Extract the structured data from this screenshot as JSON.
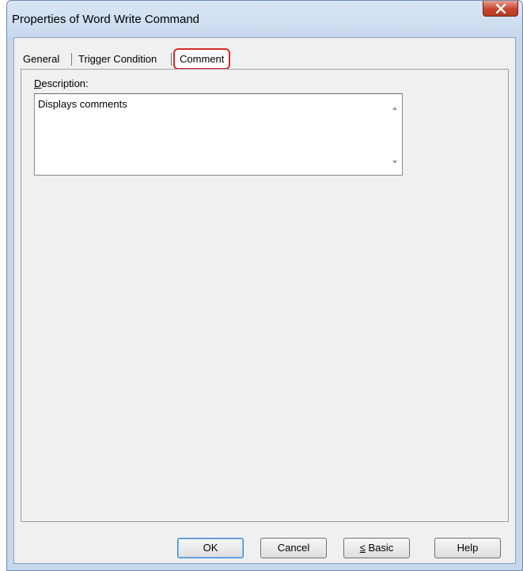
{
  "window": {
    "title": "Properties of Word Write Command",
    "close_icon": "close-icon"
  },
  "tabs": [
    {
      "label": "General"
    },
    {
      "label": "Trigger Condition"
    },
    {
      "label": "Comment",
      "active": true
    }
  ],
  "description": {
    "label_first": "D",
    "label_rest": "escription:",
    "value": "Displays comments"
  },
  "buttons": {
    "ok": "OK",
    "cancel": "Cancel",
    "basic_prefix": "≤",
    "basic_rest": " Basic",
    "help": "Help"
  },
  "colors": {
    "accent_highlight": "#d42b2b",
    "close_button": "#c8452e"
  }
}
